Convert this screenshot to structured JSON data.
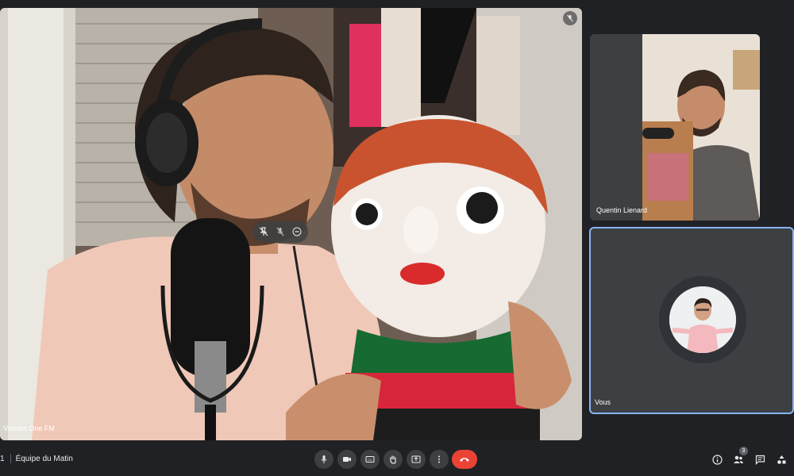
{
  "meeting": {
    "name": "Équipe du Matin",
    "time_fragment": "1"
  },
  "participants": {
    "main": {
      "name": "Vincent One FM"
    },
    "second": {
      "name": "Quentin Lienard"
    },
    "self": {
      "name": "Vous"
    }
  },
  "people_count": "3",
  "icons": {
    "mic": "mic-icon",
    "camera": "camera-icon",
    "captions": "captions-icon",
    "hand": "raise-hand-icon",
    "present": "present-icon",
    "more": "more-options-icon",
    "end": "end-call-icon",
    "info": "info-icon",
    "people": "people-icon",
    "chat": "chat-icon",
    "activities": "activities-icon"
  },
  "colors": {
    "background": "#202124",
    "tile": "#3c4043",
    "active_border": "#8ab4f8",
    "end_call": "#ea4335"
  }
}
